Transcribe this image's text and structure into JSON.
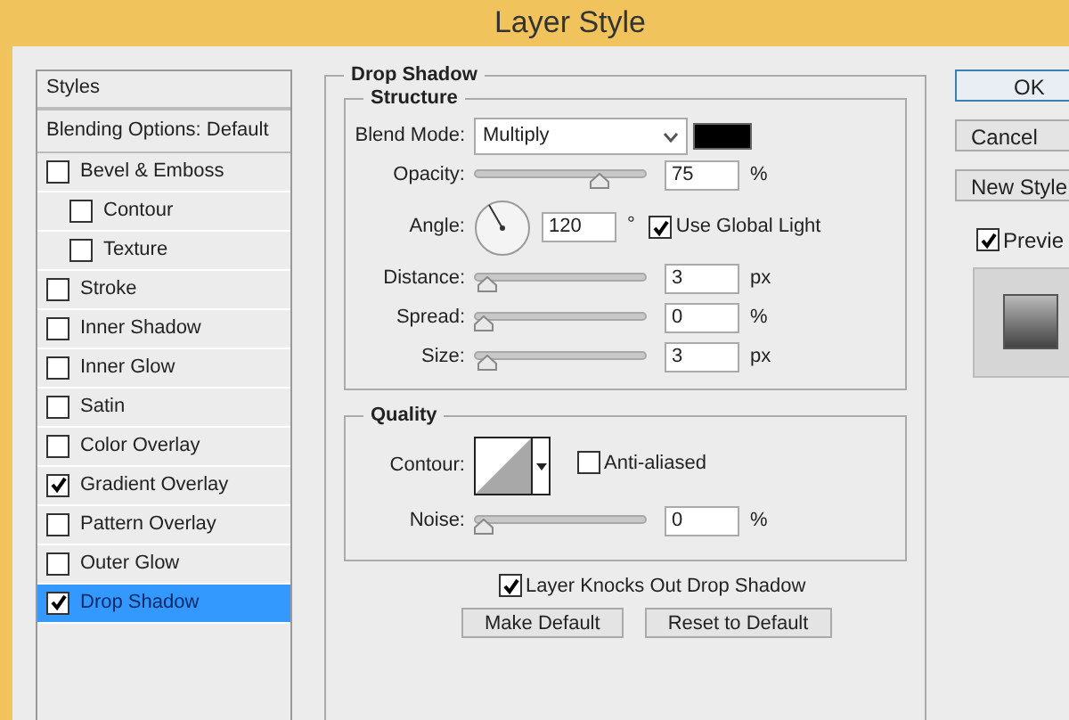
{
  "window": {
    "title": "Layer Style"
  },
  "styles_panel": {
    "header": "Styles",
    "blending": "Blending Options: Default",
    "items": [
      {
        "label": "Bevel & Emboss",
        "checked": false,
        "selected": false,
        "children": [
          {
            "label": "Contour",
            "checked": false,
            "selected": false
          },
          {
            "label": "Texture",
            "checked": false,
            "selected": false
          }
        ]
      },
      {
        "label": "Stroke",
        "checked": false,
        "selected": false
      },
      {
        "label": "Inner Shadow",
        "checked": false,
        "selected": false
      },
      {
        "label": "Inner Glow",
        "checked": false,
        "selected": false
      },
      {
        "label": "Satin",
        "checked": false,
        "selected": false
      },
      {
        "label": "Color Overlay",
        "checked": false,
        "selected": false
      },
      {
        "label": "Gradient Overlay",
        "checked": true,
        "selected": false
      },
      {
        "label": "Pattern Overlay",
        "checked": false,
        "selected": false
      },
      {
        "label": "Outer Glow",
        "checked": false,
        "selected": false
      },
      {
        "label": "Drop Shadow",
        "checked": true,
        "selected": true
      }
    ]
  },
  "drop_shadow": {
    "title": "Drop Shadow",
    "structure": {
      "title": "Structure",
      "rows": [
        {
          "kind": "blend",
          "label": "Blend Mode:",
          "value": "Multiply",
          "color": "#000000"
        },
        {
          "kind": "slider",
          "label": "Opacity:",
          "level": 0.75,
          "value": "75",
          "unit": "%"
        },
        {
          "kind": "angle",
          "label": "Angle:",
          "value": "120",
          "unit": "°",
          "global_light": {
            "label": "Use Global Light",
            "checked": true
          }
        },
        {
          "kind": "slider",
          "label": "Distance:",
          "level": 0.02,
          "value": "3",
          "unit": "px"
        },
        {
          "kind": "slider",
          "label": "Spread:",
          "level": 0,
          "value": "0",
          "unit": "%"
        },
        {
          "kind": "slider",
          "label": "Size:",
          "level": 0.02,
          "value": "3",
          "unit": "px"
        }
      ]
    },
    "quality": {
      "title": "Quality",
      "contour_label": "Contour:",
      "anti_aliased": {
        "label": "Anti-aliased",
        "checked": false
      },
      "noise": {
        "label": "Noise:",
        "level": 0,
        "value": "0",
        "unit": "%"
      }
    },
    "knockout": {
      "label": "Layer Knocks Out Drop Shadow",
      "checked": true
    },
    "buttons": [
      "Make Default",
      "Reset to Default"
    ]
  },
  "side_buttons": [
    {
      "label": "OK",
      "default": true
    },
    {
      "label": "Cancel",
      "default": false
    },
    {
      "label": "New Style",
      "default": false
    }
  ],
  "preview": {
    "label": "Previe",
    "checked": true
  }
}
